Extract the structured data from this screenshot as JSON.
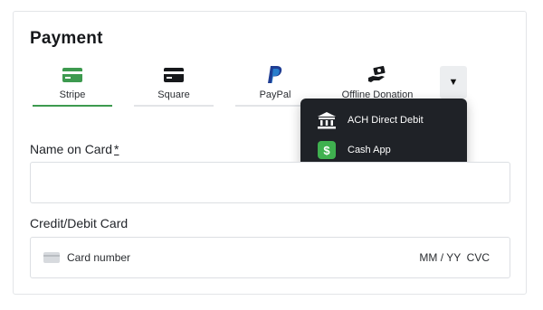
{
  "payment": {
    "title": "Payment",
    "tabs": [
      {
        "label": "Stripe",
        "icon": "credit-card-icon",
        "active": true,
        "color": "#3d9a4f"
      },
      {
        "label": "Square",
        "icon": "square-card-icon",
        "active": false
      },
      {
        "label": "PayPal",
        "icon": "paypal-icon",
        "active": false
      },
      {
        "label": "Offline Donation",
        "icon": "money-hand-icon",
        "active": false
      }
    ],
    "more_button": "▼",
    "dropdown": {
      "items": [
        {
          "label": "ACH Direct Debit",
          "icon": "bank-icon"
        },
        {
          "label": "Cash App",
          "icon": "cash-app-icon",
          "color": "#3fb04f"
        }
      ]
    },
    "name_on_card": {
      "label": "Name on Card",
      "required_mark": "*",
      "value": ""
    },
    "card": {
      "label": "Credit/Debit Card",
      "number_placeholder": "Card number",
      "expiry_cvc_placeholder": "MM / YY  CVC"
    }
  }
}
